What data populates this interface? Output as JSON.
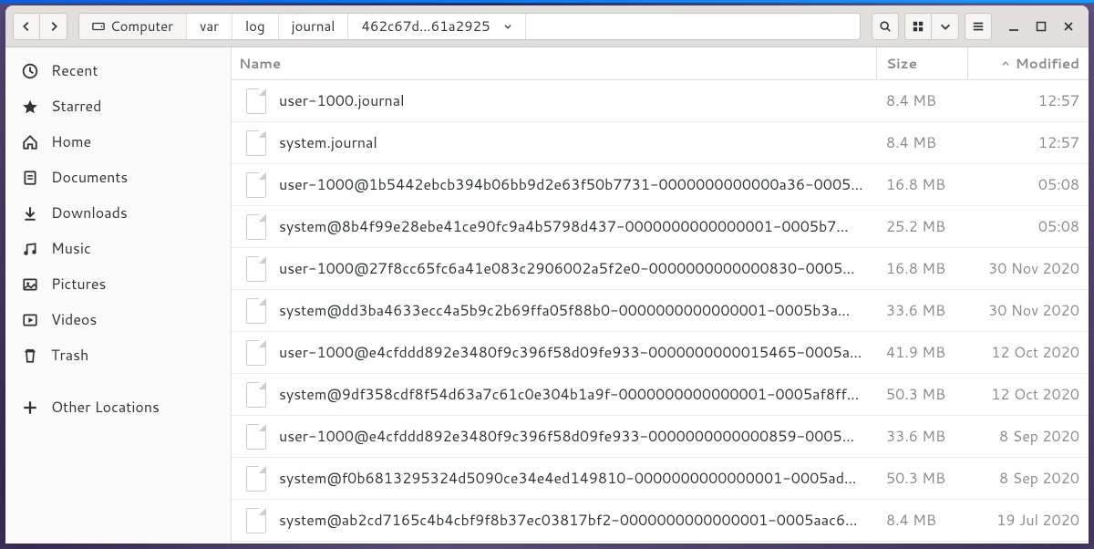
{
  "path": {
    "root_label": "Computer",
    "segments": [
      "var",
      "log",
      "journal"
    ],
    "current": "462c67d…61a2925"
  },
  "columns": {
    "name": "Name",
    "size": "Size",
    "modified": "Modified"
  },
  "sidebar": {
    "items": [
      {
        "icon": "clock-icon",
        "label": "Recent"
      },
      {
        "icon": "star-icon",
        "label": "Starred"
      },
      {
        "icon": "home-icon",
        "label": "Home"
      },
      {
        "icon": "documents-icon",
        "label": "Documents"
      },
      {
        "icon": "downloads-icon",
        "label": "Downloads"
      },
      {
        "icon": "music-icon",
        "label": "Music"
      },
      {
        "icon": "pictures-icon",
        "label": "Pictures"
      },
      {
        "icon": "videos-icon",
        "label": "Videos"
      },
      {
        "icon": "trash-icon",
        "label": "Trash"
      }
    ],
    "other": {
      "icon": "plus-icon",
      "label": "Other Locations"
    }
  },
  "files": [
    {
      "name": "user-1000.journal",
      "size": "8.4 MB",
      "modified": "12:57"
    },
    {
      "name": "system.journal",
      "size": "8.4 MB",
      "modified": "12:57"
    },
    {
      "name": "user-1000@1b5442ebcb394b06bb9d2e63f50b7731-0000000000000a36-0005…",
      "size": "16.8 MB",
      "modified": "05:08"
    },
    {
      "name": "system@8b4f99e28ebe41ce90fc9a4b5798d437-0000000000000001-0005b7…",
      "size": "25.2 MB",
      "modified": "05:08"
    },
    {
      "name": "user-1000@27f8cc65fc6a41e083c2906002a5f2e0-0000000000000830-0005…",
      "size": "16.8 MB",
      "modified": "30 Nov 2020"
    },
    {
      "name": "system@dd3ba4633ecc4a5b9c2b69ffa05f88b0-0000000000000001-0005b3a…",
      "size": "33.6 MB",
      "modified": "30 Nov 2020"
    },
    {
      "name": "user-1000@e4cfddd892e3480f9c396f58d09fe933-0000000000015465-0005a…",
      "size": "41.9 MB",
      "modified": "12 Oct 2020"
    },
    {
      "name": "system@9df358cdf8f54d63a7c61c0e304b1a9f-0000000000000001-0005af8ff…",
      "size": "50.3 MB",
      "modified": "12 Oct 2020"
    },
    {
      "name": "user-1000@e4cfddd892e3480f9c396f58d09fe933-0000000000000859-0005…",
      "size": "33.6 MB",
      "modified": "8 Sep 2020"
    },
    {
      "name": "system@f0b6813295324d5090ce34e4ed149810-0000000000000001-0005ad…",
      "size": "50.3 MB",
      "modified": "8 Sep 2020"
    },
    {
      "name": "system@ab2cd7165c4b4cbf9f8b37ec03817bf2-0000000000000001-0005aac6…",
      "size": "8.4 MB",
      "modified": "19 Jul 2020"
    }
  ]
}
